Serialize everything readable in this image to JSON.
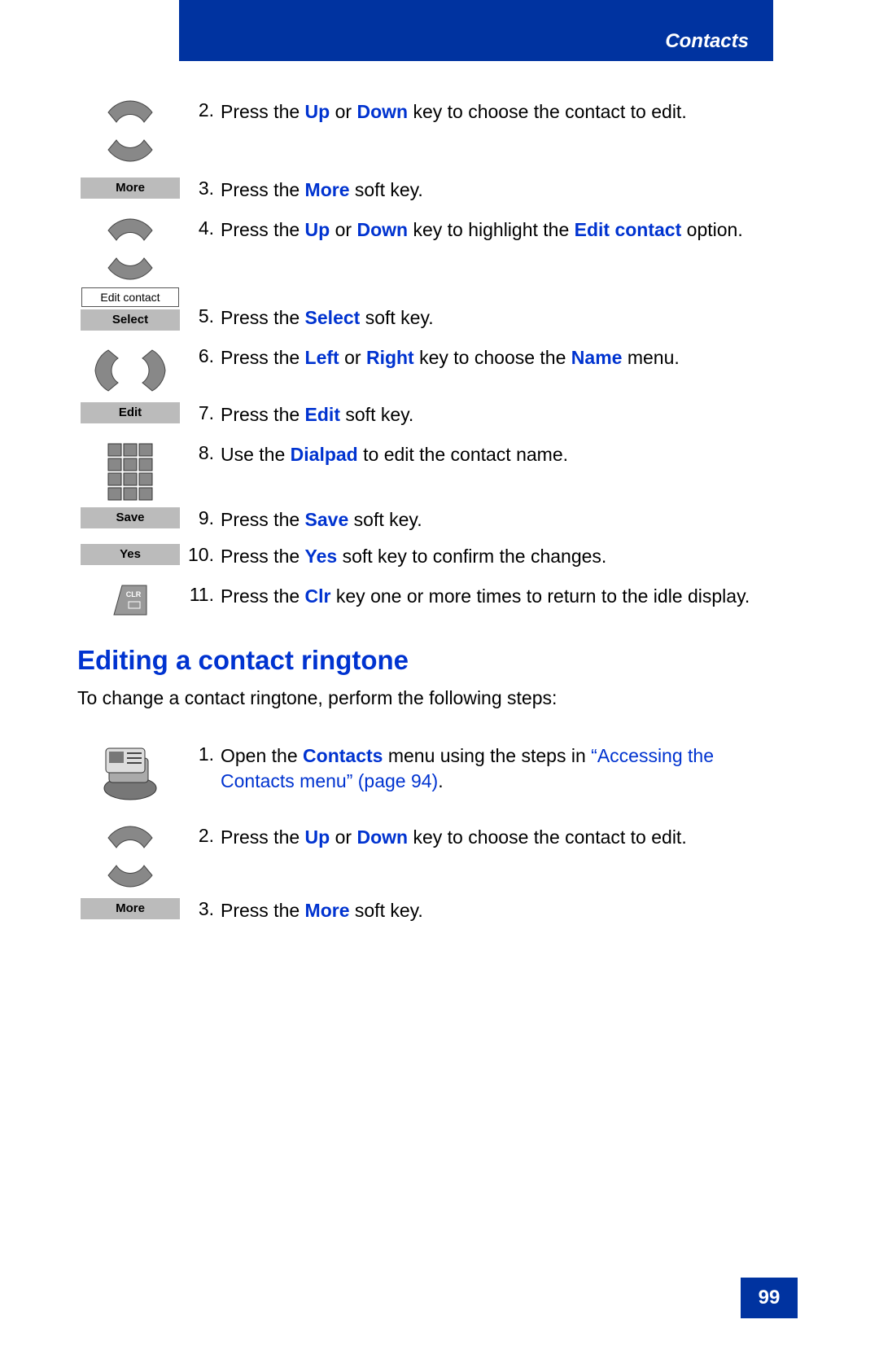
{
  "header": {
    "section_title": "Contacts"
  },
  "softkeys": {
    "more": "More",
    "edit_contact_option": "Edit contact",
    "select": "Select",
    "edit": "Edit",
    "save": "Save",
    "yes": "Yes"
  },
  "steps_a": [
    {
      "n": "2.",
      "parts": [
        {
          "t": "Press the "
        },
        {
          "t": "Up",
          "kw": true
        },
        {
          "t": " or "
        },
        {
          "t": "Down",
          "kw": true
        },
        {
          "t": " key to choose the contact to edit."
        }
      ]
    },
    {
      "n": "3.",
      "parts": [
        {
          "t": "Press the "
        },
        {
          "t": "More",
          "kw": true
        },
        {
          "t": " soft key."
        }
      ]
    },
    {
      "n": "4.",
      "parts": [
        {
          "t": "Press the "
        },
        {
          "t": "Up",
          "kw": true
        },
        {
          "t": " or "
        },
        {
          "t": "Down",
          "kw": true
        },
        {
          "t": " key to highlight the "
        },
        {
          "t": "Edit contact",
          "kw": true
        },
        {
          "t": " option."
        }
      ]
    },
    {
      "n": "5.",
      "parts": [
        {
          "t": "Press the "
        },
        {
          "t": "Select",
          "kw": true
        },
        {
          "t": " soft key."
        }
      ]
    },
    {
      "n": "6.",
      "parts": [
        {
          "t": "Press the "
        },
        {
          "t": "Left",
          "kw": true
        },
        {
          "t": " or "
        },
        {
          "t": "Right",
          "kw": true
        },
        {
          "t": " key to choose the "
        },
        {
          "t": "Name",
          "kw": true
        },
        {
          "t": " menu."
        }
      ]
    },
    {
      "n": "7.",
      "parts": [
        {
          "t": "Press the "
        },
        {
          "t": "Edit",
          "kw": true
        },
        {
          "t": " soft key."
        }
      ]
    },
    {
      "n": "8.",
      "parts": [
        {
          "t": "Use the "
        },
        {
          "t": "Dialpad",
          "kw": true
        },
        {
          "t": " to edit the contact name."
        }
      ]
    },
    {
      "n": "9.",
      "parts": [
        {
          "t": "Press the "
        },
        {
          "t": "Save",
          "kw": true
        },
        {
          "t": " soft key."
        }
      ]
    },
    {
      "n": "10.",
      "parts": [
        {
          "t": "Press the "
        },
        {
          "t": "Yes",
          "kw": true
        },
        {
          "t": " soft key to confirm the changes."
        }
      ]
    },
    {
      "n": "11.",
      "parts": [
        {
          "t": "Press the "
        },
        {
          "t": "Clr",
          "kw": true
        },
        {
          "t": " key one or more times to return to the idle display."
        }
      ]
    }
  ],
  "section_b": {
    "heading": "Editing a contact ringtone",
    "intro": "To change a contact ringtone, perform the following steps:"
  },
  "steps_b": [
    {
      "n": "1.",
      "parts": [
        {
          "t": "Open the "
        },
        {
          "t": "Contacts",
          "kw": true
        },
        {
          "t": " menu using the steps in "
        },
        {
          "t": "“Accessing the Contacts menu” (page 94)",
          "link": true
        },
        {
          "t": "."
        }
      ]
    },
    {
      "n": "2.",
      "parts": [
        {
          "t": "Press the "
        },
        {
          "t": "Up",
          "kw": true
        },
        {
          "t": " or "
        },
        {
          "t": "Down",
          "kw": true
        },
        {
          "t": " key to choose the contact to edit."
        }
      ]
    },
    {
      "n": "3.",
      "parts": [
        {
          "t": "Press the "
        },
        {
          "t": "More",
          "kw": true
        },
        {
          "t": " soft key."
        }
      ]
    }
  ],
  "page_number": "99"
}
